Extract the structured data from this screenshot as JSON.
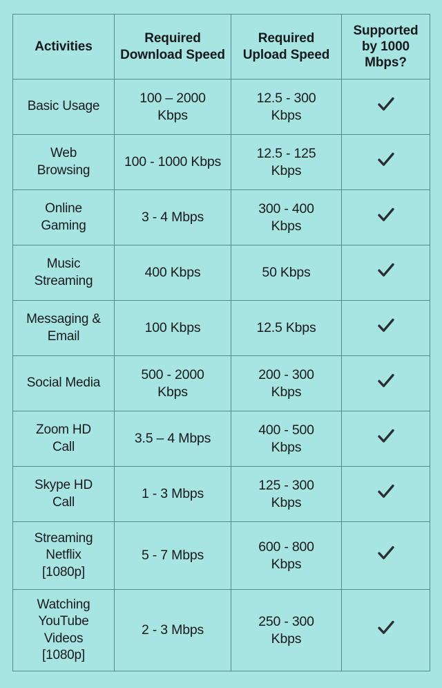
{
  "page": {
    "background_color": "#a7e5e2",
    "border_color": "#568a8a",
    "text_color": "#16191c"
  },
  "table": {
    "headers": [
      "Activities",
      "Required Download Speed",
      "Required Upload Speed",
      "Supported by 1000 Mbps?"
    ],
    "header_lines": {
      "activities": [
        "Activities"
      ],
      "download": [
        "Required",
        "Download Speed"
      ],
      "upload": [
        "Required",
        "Upload Speed"
      ],
      "supported": [
        "Supported",
        "by 1000",
        "Mbps?"
      ]
    },
    "supported_icon": "check-icon",
    "rows": [
      {
        "activity": "Basic Usage",
        "activity_lines": [
          "Basic Usage"
        ],
        "download": "100 – 2000 Kbps",
        "download_lines": [
          "100 – 2000",
          "Kbps"
        ],
        "upload": "12.5 - 300 Kbps",
        "upload_lines": [
          "12.5 - 300",
          "Kbps"
        ],
        "supported": true
      },
      {
        "activity": "Web Browsing",
        "activity_lines": [
          "Web",
          "Browsing"
        ],
        "download": "100 - 1000 Kbps",
        "download_lines": [
          "100 - 1000 Kbps"
        ],
        "upload": "12.5 - 125 Kbps",
        "upload_lines": [
          "12.5 - 125",
          "Kbps"
        ],
        "supported": true
      },
      {
        "activity": "Online Gaming",
        "activity_lines": [
          "Online",
          "Gaming"
        ],
        "download": "3 - 4 Mbps",
        "download_lines": [
          "3 - 4 Mbps"
        ],
        "upload": "300 - 400 Kbps",
        "upload_lines": [
          "300 - 400",
          "Kbps"
        ],
        "supported": true
      },
      {
        "activity": "Music Streaming",
        "activity_lines": [
          "Music",
          "Streaming"
        ],
        "download": "400 Kbps",
        "download_lines": [
          "400 Kbps"
        ],
        "upload": "50 Kbps",
        "upload_lines": [
          "50 Kbps"
        ],
        "supported": true
      },
      {
        "activity": "Messaging & Email",
        "activity_lines": [
          "Messaging &",
          "Email"
        ],
        "download": "100 Kbps",
        "download_lines": [
          "100 Kbps"
        ],
        "upload": "12.5 Kbps",
        "upload_lines": [
          "12.5 Kbps"
        ],
        "supported": true
      },
      {
        "activity": "Social Media",
        "activity_lines": [
          "Social Media"
        ],
        "download": "500 - 2000 Kbps",
        "download_lines": [
          "500 - 2000",
          "Kbps"
        ],
        "upload": "200 - 300 Kbps",
        "upload_lines": [
          "200 - 300",
          "Kbps"
        ],
        "supported": true
      },
      {
        "activity": "Zoom HD Call",
        "activity_lines": [
          "Zoom HD",
          "Call"
        ],
        "download": "3.5 – 4 Mbps",
        "download_lines": [
          "3.5 – 4 Mbps"
        ],
        "upload": "400 - 500 Kbps",
        "upload_lines": [
          "400 - 500",
          "Kbps"
        ],
        "supported": true
      },
      {
        "activity": "Skype HD Call",
        "activity_lines": [
          "Skype HD",
          "Call"
        ],
        "download": "1 - 3 Mbps",
        "download_lines": [
          "1 - 3 Mbps"
        ],
        "upload": "125 - 300 Kbps",
        "upload_lines": [
          "125 - 300",
          "Kbps"
        ],
        "supported": true
      },
      {
        "activity": "Streaming Netflix [1080p]",
        "activity_lines": [
          "Streaming",
          "Netflix",
          "[1080p]"
        ],
        "download": "5 - 7 Mbps",
        "download_lines": [
          "5 - 7 Mbps"
        ],
        "upload": "600 - 800 Kbps",
        "upload_lines": [
          "600 - 800",
          "Kbps"
        ],
        "supported": true
      },
      {
        "activity": "Watching YouTube Videos [1080p]",
        "activity_lines": [
          "Watching",
          "YouTube",
          "Videos",
          "[1080p]"
        ],
        "download": "2 - 3 Mbps",
        "download_lines": [
          "2 - 3 Mbps"
        ],
        "upload": "250 - 300 Kbps",
        "upload_lines": [
          "250 - 300",
          "Kbps"
        ],
        "supported": true
      }
    ]
  }
}
